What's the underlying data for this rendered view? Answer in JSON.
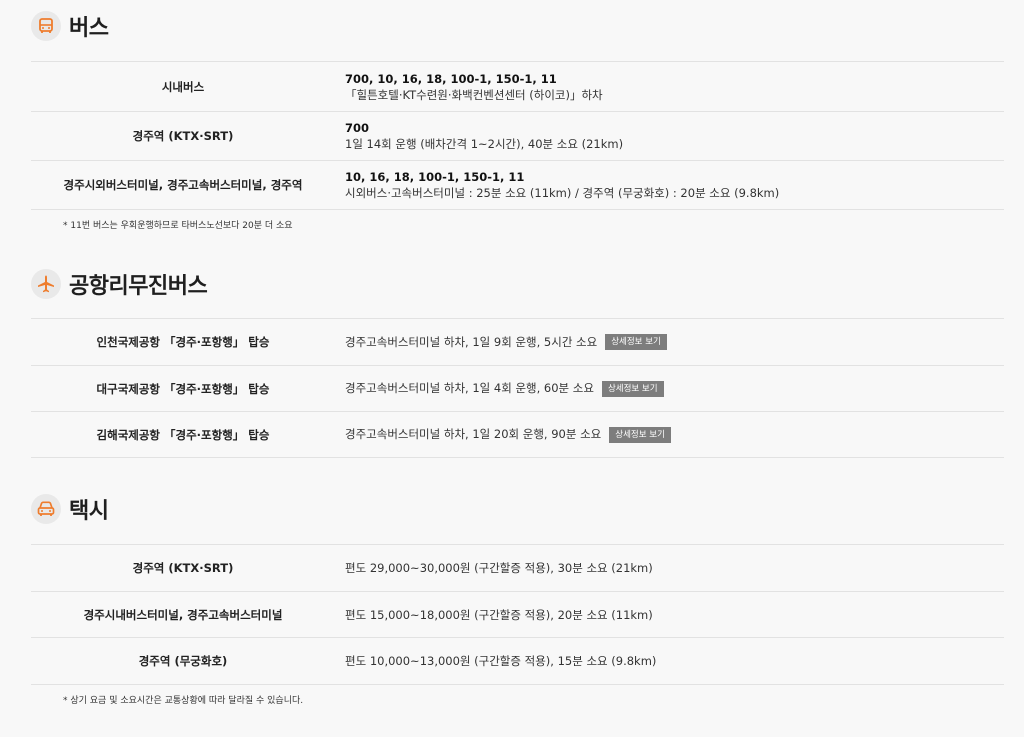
{
  "accent_color": "#ee7d2e",
  "bus": {
    "title": "버스",
    "icon": "bus-icon",
    "rows": [
      {
        "label": "시내버스",
        "main": "700, 10, 16, 18, 100-1, 150-1, 11",
        "sub": "「힐튼호텔·KT수련원·화백컨벤션센터 (하이코)」하차"
      },
      {
        "label": "경주역 (KTX·SRT)",
        "main": "700",
        "sub": "1일 14회 운행 (배차간격 1~2시간), 40분 소요 (21km)"
      },
      {
        "label": "경주시외버스터미널, 경주고속버스터미널, 경주역",
        "main": "10, 16, 18, 100-1, 150-1, 11",
        "sub": "시외버스·고속버스터미널 : 25분 소요 (11km) / 경주역 (무궁화호) : 20분 소요 (9.8km)"
      }
    ],
    "note": "* 11번 버스는 우회운행하므로 타버스노선보다 20분 더 소요"
  },
  "airport": {
    "title": "공항리무진버스",
    "icon": "airplane-icon",
    "detail_label": "상세정보 보기",
    "rows": [
      {
        "label": "인천국제공항 「경주·포항행」 탑승",
        "value": "경주고속버스터미널 하차, 1일 9회 운행, 5시간 소요"
      },
      {
        "label": "대구국제공항 「경주·포항행」 탑승",
        "value": "경주고속버스터미널 하차, 1일 4회 운행, 60분 소요"
      },
      {
        "label": "김해국제공항 「경주·포항행」 탑승",
        "value": "경주고속버스터미널 하차, 1일 20회 운행, 90분 소요"
      }
    ]
  },
  "taxi": {
    "title": "택시",
    "icon": "taxi-icon",
    "rows": [
      {
        "label": "경주역 (KTX·SRT)",
        "value": "편도 29,000~30,000원 (구간할증 적용), 30분 소요 (21km)"
      },
      {
        "label": "경주시내버스터미널, 경주고속버스터미널",
        "value": "편도 15,000~18,000원 (구간할증 적용), 20분 소요 (11km)"
      },
      {
        "label": "경주역 (무궁화호)",
        "value": "편도 10,000~13,000원 (구간할증 적용), 15분 소요 (9.8km)"
      }
    ],
    "note": "* 상기 요금 및 소요시간은 교통상황에 따라 달라질 수 있습니다."
  }
}
